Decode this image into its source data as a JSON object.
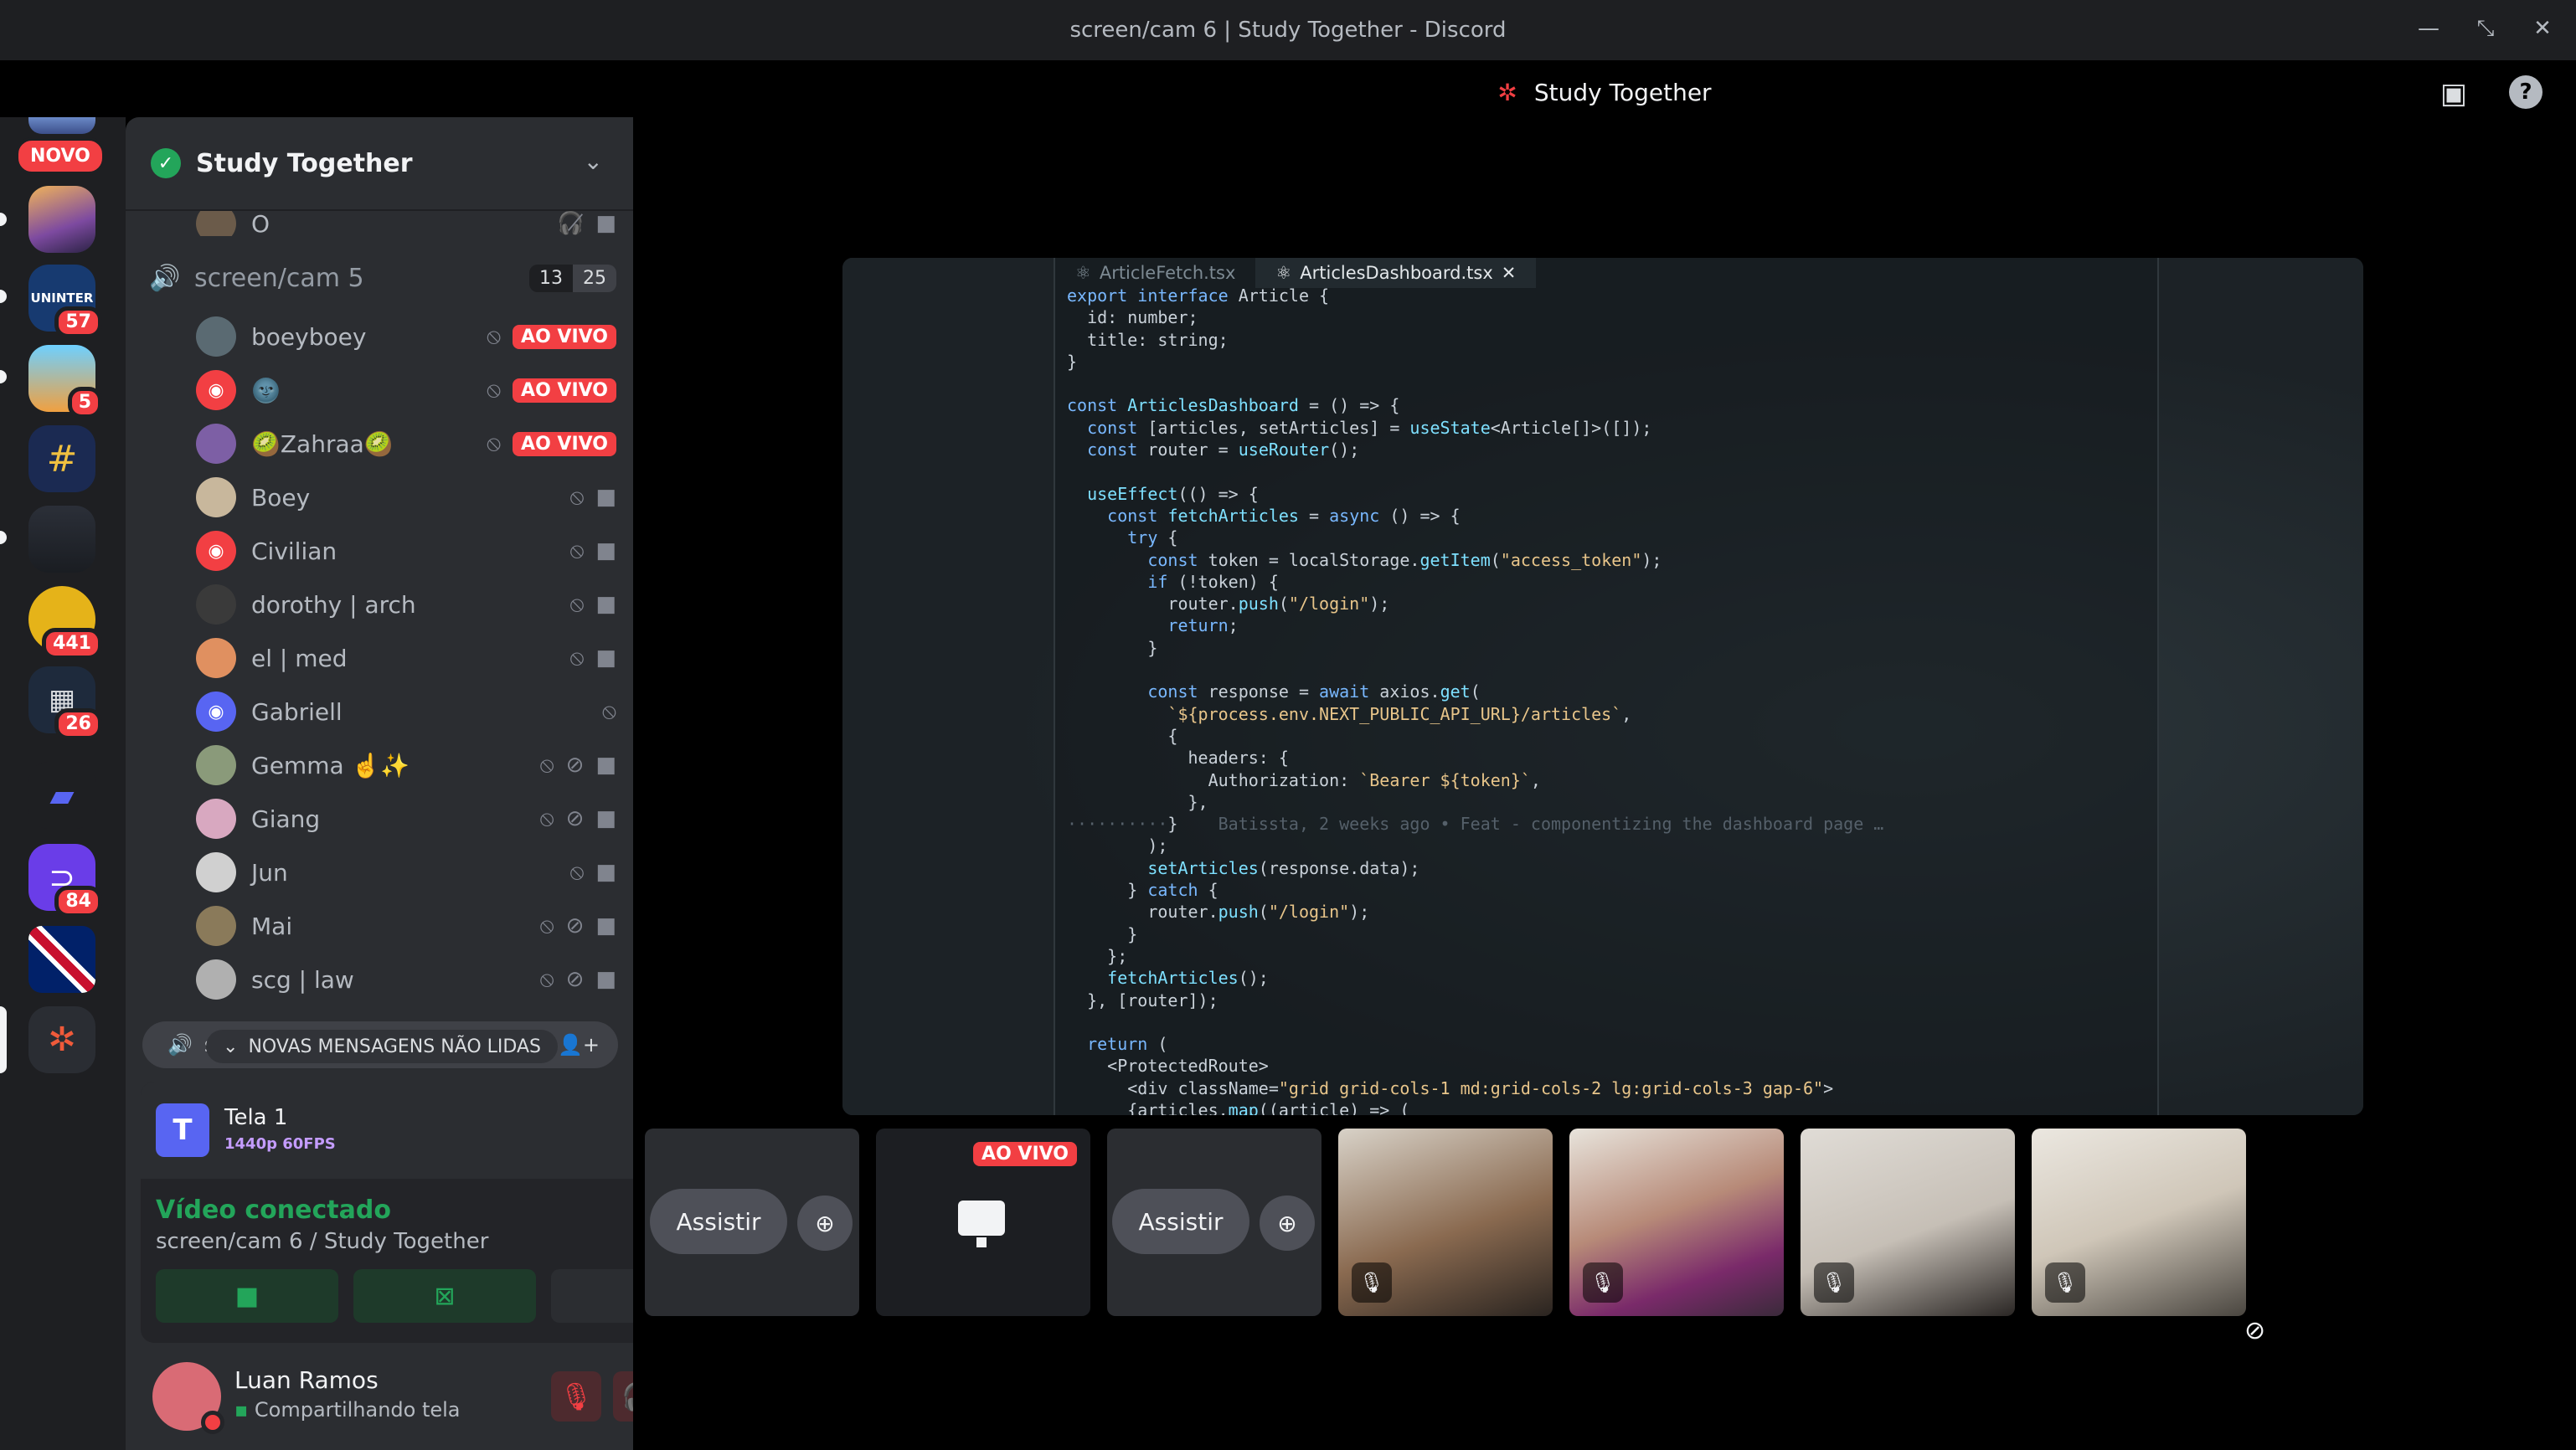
{
  "window": {
    "title": "screen/cam 6 | Study Together - Discord"
  },
  "rail": {
    "novo_badge": "NOVO",
    "servers": [
      {
        "name": "uninter",
        "label": "UNINTER",
        "badge": "57"
      },
      {
        "name": "anime",
        "badge": "5"
      },
      {
        "name": "grid-server",
        "badge": ""
      },
      {
        "name": "code-server",
        "badge": ""
      },
      {
        "name": "avatar-server",
        "badge": "441"
      },
      {
        "name": "qr-server",
        "badge": "26"
      },
      {
        "name": "folder",
        "badge": ""
      },
      {
        "name": "purple-server",
        "badge": "84"
      },
      {
        "name": "uk-server",
        "badge": ""
      },
      {
        "name": "study-together",
        "badge": ""
      }
    ]
  },
  "guild": {
    "name": "Study Together"
  },
  "channels": {
    "prev_user": "O",
    "voice_channel": {
      "name": "screen/cam 5",
      "count": "13",
      "limit": "25"
    },
    "users": [
      {
        "name": "boeyboey",
        "live": "AO VIVO"
      },
      {
        "name": "🌚",
        "live": "AO VIVO"
      },
      {
        "name": "🥝Zahraa🥝",
        "live": "AO VIVO"
      },
      {
        "name": "Boey",
        "live": ""
      },
      {
        "name": "Civilian",
        "live": ""
      },
      {
        "name": "dorothy | arch",
        "live": ""
      },
      {
        "name": "el | med",
        "live": ""
      },
      {
        "name": "Gabriell",
        "live": ""
      },
      {
        "name": "Gemma ☝️✨",
        "live": ""
      },
      {
        "name": "Giang",
        "live": ""
      },
      {
        "name": "Jun",
        "live": ""
      },
      {
        "name": "Mai",
        "live": ""
      },
      {
        "name": "scg | law",
        "live": ""
      }
    ],
    "unread_label": "NOVAS MENSAGENS NÃO LIDAS",
    "unread_prefix": "s"
  },
  "voice_panel": {
    "stream_name": "Tela 1",
    "stream_icon_letter": "T",
    "stream_quality": "1440p 60FPS",
    "status": "Vídeo conectado",
    "location": "screen/cam 6 / Study Together"
  },
  "user_panel": {
    "name": "Luan Ramos",
    "status": "Compartilhando tela"
  },
  "stage": {
    "channel_title": "Study Together",
    "editor_tabs": [
      "ArticleFetch.tsx",
      "ArticlesDashboard.tsx"
    ],
    "tab_close": "✕",
    "blame_text": "Batissta, 2 weeks ago • Feat - componentizing the dashboard page …",
    "tile_watch_label": "Assistir",
    "tile_live_label": "AO VIVO"
  },
  "colors": {
    "accent": "#5865f2",
    "live": "#f23f43",
    "online": "#23a55a"
  }
}
